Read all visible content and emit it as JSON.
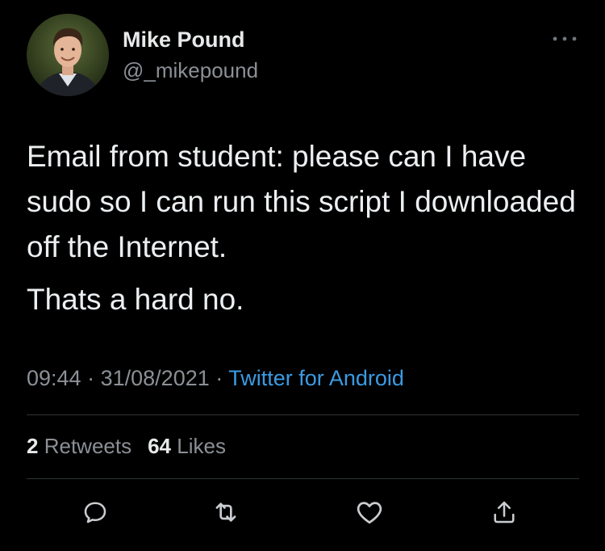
{
  "author": {
    "name": "Mike Pound",
    "handle": "@_mikepound",
    "avatar_icon": "profile-photo"
  },
  "tweet": {
    "paragraphs": [
      "Email from student: please can I have sudo so I can run this script I downloaded off the Internet.",
      "Thats a hard no."
    ],
    "time": "09:44",
    "date": "31/08/2021",
    "separator": "·",
    "source": "Twitter for Android"
  },
  "stats": {
    "retweets_count": "2",
    "retweets_label": "Retweets",
    "likes_count": "64",
    "likes_label": "Likes"
  },
  "actions": {
    "reply_icon": "reply-icon",
    "retweet_icon": "retweet-icon",
    "like_icon": "heart-icon",
    "share_icon": "share-icon"
  },
  "colors": {
    "background": "#000000",
    "text": "#e7e9ea",
    "secondary_text": "#8b9096",
    "link": "#3b9be3",
    "divider": "#2f3336"
  }
}
